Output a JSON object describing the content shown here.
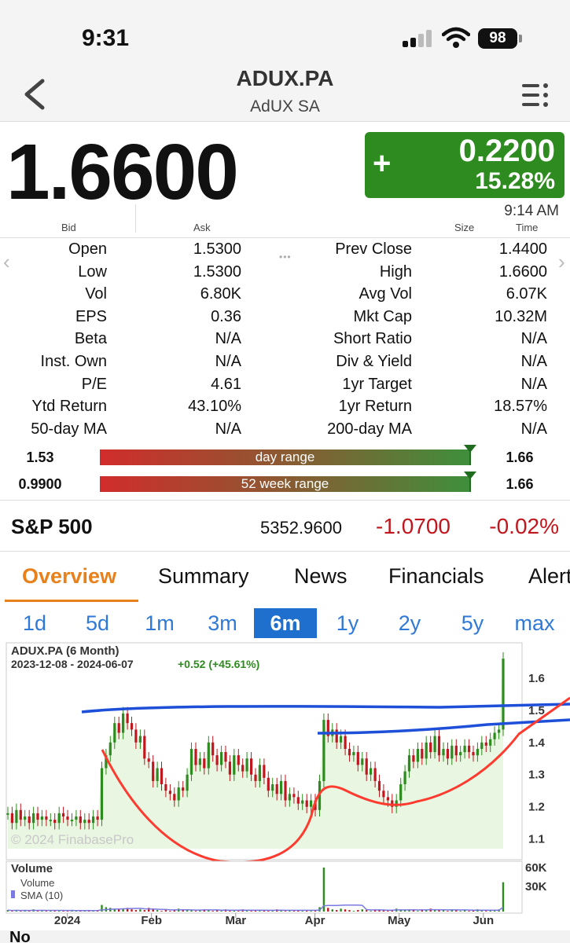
{
  "status": {
    "time": "9:31",
    "battery": "98"
  },
  "nav": {
    "symbol": "ADUX.PA",
    "company": "AdUX SA"
  },
  "quote": {
    "price": "1.6600",
    "change_sign": "+",
    "change": "0.2200",
    "change_pct": "15.28%",
    "time": "9:14 AM",
    "labels": {
      "bid": "Bid",
      "ask": "Ask",
      "size": "Size",
      "time": "Time"
    }
  },
  "stats": [
    [
      "Open",
      "1.5300",
      "Prev Close",
      "1.4400"
    ],
    [
      "Low",
      "1.5300",
      "High",
      "1.6600"
    ],
    [
      "Vol",
      "6.80K",
      "Avg Vol",
      "6.07K"
    ],
    [
      "EPS",
      "0.36",
      "Mkt Cap",
      "10.32M"
    ],
    [
      "Beta",
      "N/A",
      "Short Ratio",
      "N/A"
    ],
    [
      "Inst. Own",
      "N/A",
      "Div & Yield",
      "N/A"
    ],
    [
      "P/E",
      "4.61",
      "1yr Target",
      "N/A"
    ],
    [
      "Ytd Return",
      "43.10%",
      "1yr Return",
      "18.57%"
    ],
    [
      "50-day MA",
      "N/A",
      "200-day MA",
      "N/A"
    ]
  ],
  "ranges": {
    "day": {
      "low": "1.53",
      "high": "1.66",
      "label": "day range",
      "position": 1.0
    },
    "week52": {
      "low": "0.9900",
      "high": "1.66",
      "label": "52 week range",
      "position": 1.0
    }
  },
  "index": {
    "name": "S&P 500",
    "value": "5352.9600",
    "change": "-1.0700",
    "pct": "-0.02%"
  },
  "tabs": [
    "Overview",
    "Summary",
    "News",
    "Financials",
    "Alerts"
  ],
  "active_tab": "Overview",
  "periods": [
    "1d",
    "5d",
    "1m",
    "3m",
    "6m",
    "1y",
    "2y",
    "5y",
    "max"
  ],
  "active_period": "6m",
  "chart_data": {
    "type": "candlestick",
    "title": "ADUX.PA (6 Month)",
    "date_range": "2023-12-08 - 2024-06-07",
    "change_text": "+0.52 (+45.61%)",
    "watermark": "© 2024 FinabasePro",
    "y_ticks": [
      "1.6",
      "1.5",
      "1.4",
      "1.3",
      "1.2",
      "1.1"
    ],
    "ylim": [
      1.07,
      1.68
    ],
    "x_ticks": [
      "2024",
      "Feb",
      "Mar",
      "Apr",
      "May",
      "Jun"
    ],
    "volume_title": "Volume",
    "volume_legend": [
      "Volume",
      "SMA (10)"
    ],
    "volume_ticks": [
      "60K",
      "30K"
    ],
    "colors": {
      "up": "#2e8b1f",
      "down": "#c0161d",
      "area": "#e8f6e2",
      "sma": "#7a7ae0",
      "trendline": "#1e4fd8",
      "cup": "#ff3b30"
    },
    "closes": [
      1.18,
      1.15,
      1.19,
      1.16,
      1.17,
      1.15,
      1.18,
      1.16,
      1.17,
      1.16,
      1.16,
      1.15,
      1.18,
      1.17,
      1.16,
      1.16,
      1.17,
      1.15,
      1.16,
      1.15,
      1.17,
      1.16,
      1.32,
      1.36,
      1.4,
      1.46,
      1.43,
      1.49,
      1.46,
      1.44,
      1.4,
      1.42,
      1.35,
      1.34,
      1.28,
      1.32,
      1.27,
      1.25,
      1.24,
      1.22,
      1.26,
      1.25,
      1.3,
      1.38,
      1.33,
      1.35,
      1.32,
      1.4,
      1.36,
      1.33,
      1.37,
      1.34,
      1.3,
      1.36,
      1.33,
      1.31,
      1.35,
      1.3,
      1.28,
      1.33,
      1.29,
      1.25,
      1.27,
      1.24,
      1.28,
      1.22,
      1.24,
      1.23,
      1.21,
      1.22,
      1.2,
      1.22,
      1.19,
      1.28,
      1.47,
      1.42,
      1.44,
      1.4,
      1.42,
      1.38,
      1.36,
      1.37,
      1.33,
      1.35,
      1.3,
      1.32,
      1.28,
      1.25,
      1.23,
      1.22,
      1.2,
      1.22,
      1.27,
      1.31,
      1.36,
      1.34,
      1.38,
      1.35,
      1.4,
      1.37,
      1.42,
      1.36,
      1.38,
      1.35,
      1.39,
      1.36,
      1.37,
      1.39,
      1.37,
      1.36,
      1.38,
      1.4,
      1.39,
      1.41,
      1.43,
      1.44,
      1.66
    ],
    "volumes": [
      2,
      1,
      2,
      1,
      2,
      1,
      3,
      1,
      2,
      1,
      2,
      1,
      2,
      1,
      1,
      2,
      1,
      2,
      1,
      2,
      1,
      2,
      9,
      6,
      5,
      4,
      3,
      4,
      5,
      3,
      2,
      3,
      2,
      5,
      3,
      2,
      1,
      2,
      1,
      2,
      4,
      2,
      3,
      2,
      1,
      2,
      3,
      2,
      1,
      2,
      1,
      3,
      2,
      2,
      1,
      3,
      2,
      1,
      2,
      1,
      2,
      1,
      2,
      3,
      2,
      1,
      2,
      1,
      2,
      1,
      2,
      1,
      2,
      6,
      60,
      5,
      3,
      2,
      4,
      3,
      2,
      1,
      2,
      3,
      2,
      1,
      2,
      3,
      2,
      1,
      2,
      4,
      3,
      2,
      3,
      2,
      1,
      3,
      2,
      4,
      2,
      3,
      2,
      1,
      3,
      2,
      1,
      2,
      1,
      2,
      3,
      2,
      1,
      2,
      2,
      3,
      40
    ]
  },
  "footer_peek": "No"
}
